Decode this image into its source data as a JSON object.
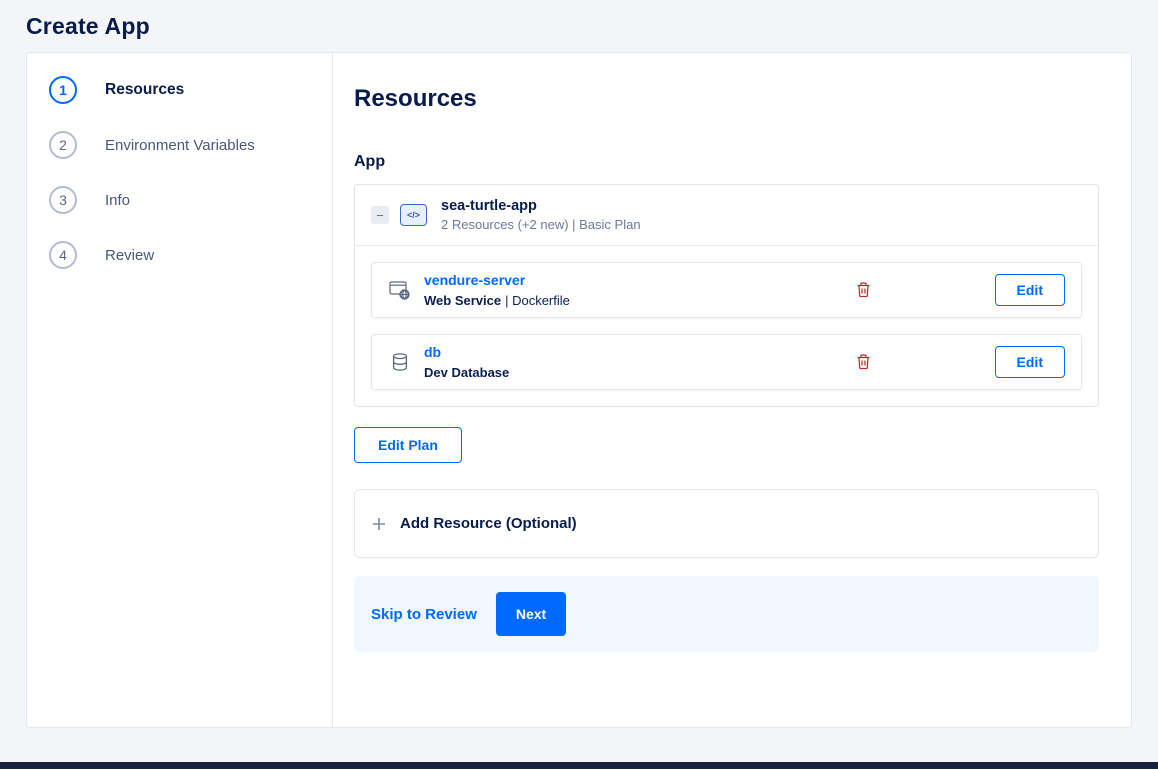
{
  "page": {
    "title": "Create App"
  },
  "stepper": {
    "steps": [
      {
        "number": "1",
        "label": "Resources",
        "active": true
      },
      {
        "number": "2",
        "label": "Environment Variables",
        "active": false
      },
      {
        "number": "3",
        "label": "Info",
        "active": false
      },
      {
        "number": "4",
        "label": "Review",
        "active": false
      }
    ]
  },
  "main": {
    "heading": "Resources",
    "section_label": "App",
    "app": {
      "collapse_symbol": "−",
      "icon_glyph": "</>",
      "name": "sea-turtle-app",
      "summary": "2 Resources (+2 new) | Basic Plan",
      "resources": [
        {
          "name": "vendure-server",
          "type": "Web Service",
          "detail": "| Dockerfile",
          "icon": "web-service-icon",
          "edit_label": "Edit"
        },
        {
          "name": "db",
          "type": "Dev Database",
          "detail": "",
          "icon": "database-icon",
          "edit_label": "Edit"
        }
      ]
    },
    "edit_plan_label": "Edit Plan",
    "add_resource_label": "Add Resource (Optional)",
    "footer": {
      "skip_label": "Skip to Review",
      "next_label": "Next"
    }
  },
  "colors": {
    "accent": "#0069ff",
    "danger": "#c42b2b",
    "heading": "#071c4d",
    "footer_bar_bg": "#f0f7fe",
    "page_bg": "#f3f5f9"
  }
}
